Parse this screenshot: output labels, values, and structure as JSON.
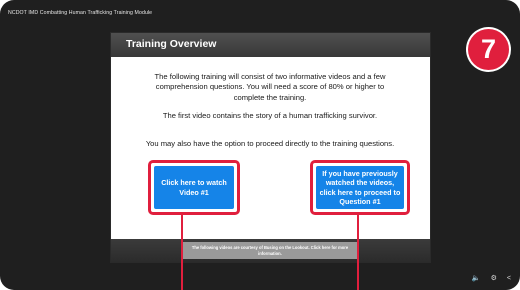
{
  "window": {
    "title": "NCDOT IMD Combatting Human Trafficking Training Module"
  },
  "slide": {
    "title": "Training Overview",
    "paragraphs": [
      "The following training will consist of two informative videos and a few comprehension questions. You will need a score of 80% or higher to complete the training.",
      "The first video contains the story of a human trafficking survivor.",
      "You may also have the option to proceed directly to the training questions."
    ],
    "buttons": {
      "watch_video": "Click here to watch Video #1",
      "proceed_question": "If you have previously watched the videos, click here to proceed to Question #1"
    },
    "footer_note": "The following videos are courtesy of Busing on the Lookout. Click here for more information."
  },
  "step_badge": "7",
  "player_controls": {
    "volume_icon": "🔈",
    "settings_icon": "⚙",
    "back_icon": "<"
  },
  "colors": {
    "accent_red": "#e01f3d",
    "button_blue": "#1584e8"
  }
}
